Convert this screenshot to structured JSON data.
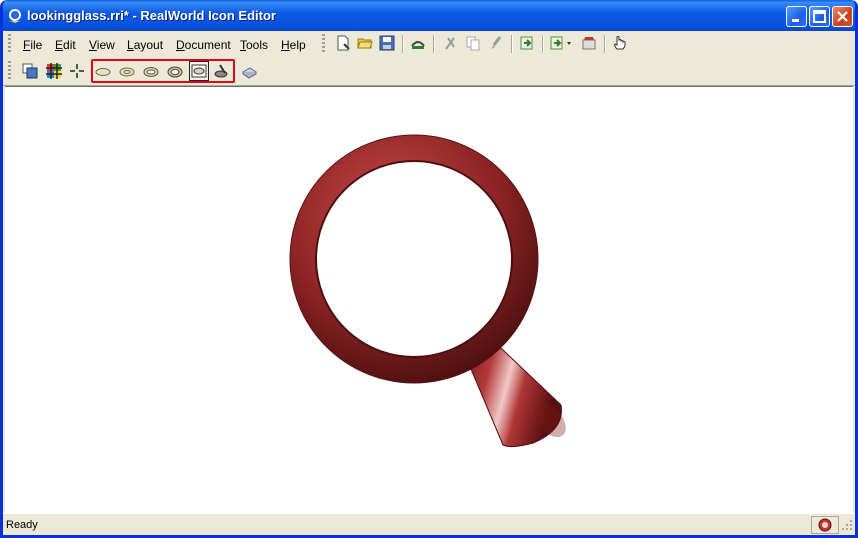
{
  "window": {
    "title": "lookingglass.rri* - RealWorld Icon Editor"
  },
  "menu": {
    "items": [
      {
        "mnemonic": "F",
        "rest": "ile"
      },
      {
        "mnemonic": "E",
        "rest": "dit"
      },
      {
        "mnemonic": "V",
        "rest": "iew"
      },
      {
        "mnemonic": "L",
        "rest": "ayout"
      },
      {
        "mnemonic": "D",
        "rest": "ocument"
      },
      {
        "mnemonic": "T",
        "rest": "ools"
      },
      {
        "mnemonic": "H",
        "rest": "elp"
      }
    ]
  },
  "toolbar_main": {
    "icons": [
      "new-document-icon",
      "open-folder-icon",
      "save-icon",
      "undo-icon",
      "cut-icon",
      "copy-icon",
      "paste-brush-icon",
      "import-icon",
      "export-icon",
      "properties-icon",
      "hand-pointer-icon"
    ]
  },
  "toolbar_layers": {
    "icons": [
      "layer-grid-icon",
      "color-palette-icon",
      "crosshair-icon",
      "shape-ellipse-1-icon",
      "shape-ellipse-2-icon",
      "shape-ellipse-3-icon",
      "shape-ellipse-4-icon",
      "shape-box-icon",
      "shape-torus-icon",
      "print-preview-icon"
    ]
  },
  "colors": {
    "accent_red": "#e3001b",
    "titlebar_blue": "#0a5fe8",
    "magnifier_red": "#9c2a2a"
  },
  "status": {
    "text": "Ready"
  }
}
